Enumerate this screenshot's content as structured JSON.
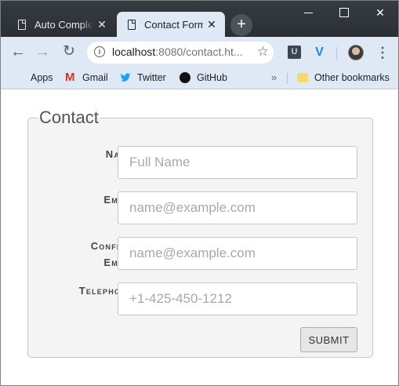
{
  "browser": {
    "tabs": [
      {
        "title": "Auto Complete",
        "close": "✕",
        "active": false
      },
      {
        "title": "Contact Form",
        "close": "✕",
        "active": true
      }
    ],
    "new_tab": "+",
    "window_controls": {
      "minimize": "minimize",
      "maximize": "maximize",
      "close": "✕"
    },
    "nav": {
      "back": "←",
      "forward": "→",
      "reload": "↻"
    },
    "url": {
      "host": "localhost",
      "rest": ":8080/contact.ht..."
    },
    "star": "☆",
    "extensions": [
      {
        "icon": "ublock-icon",
        "glyph": "U"
      },
      {
        "icon": "vimium-icon",
        "glyph": "V"
      }
    ],
    "menu": "⋮",
    "bookmarks": [
      {
        "label": "Apps",
        "icon": "apps-grid-icon"
      },
      {
        "label": "Gmail",
        "icon": "gmail-icon"
      },
      {
        "label": "Twitter",
        "icon": "twitter-icon"
      },
      {
        "label": "GitHub",
        "icon": "github-icon"
      }
    ],
    "bookmarks_overflow": "»",
    "other_bookmarks": "Other bookmarks"
  },
  "form": {
    "legend": "Contact",
    "fields": [
      {
        "label": "Name",
        "placeholder": "Full Name"
      },
      {
        "label": "Email",
        "placeholder": "name@example.com"
      },
      {
        "label": "Confirm Email",
        "placeholder": "name@example.com"
      },
      {
        "label": "Telephone",
        "placeholder": "+1-425-450-1212"
      }
    ],
    "submit": "SUBMIT"
  },
  "colors": {
    "tabstrip": "#2b3036",
    "toolbar": "#dfe9f5",
    "fieldset_bg": "#f4f4f4",
    "label_text": "#444444"
  }
}
